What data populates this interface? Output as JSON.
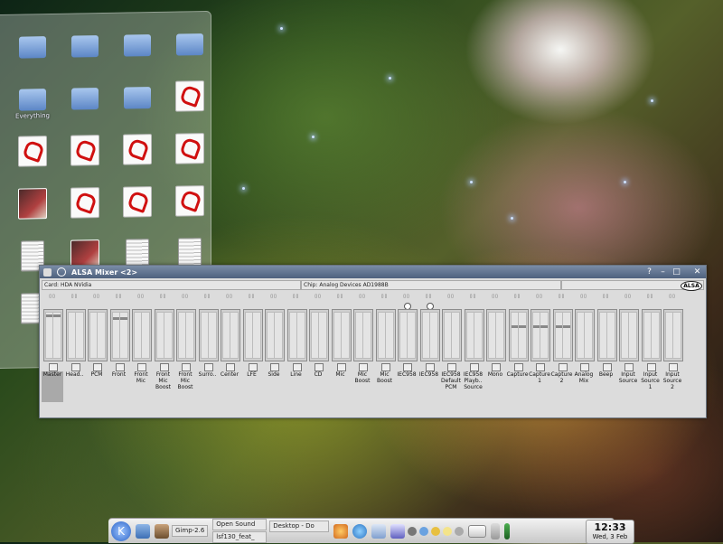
{
  "colors": {
    "titlebar": "#5b6e8a",
    "window_bg": "#dcdcdc"
  },
  "folder_view": {
    "items": [
      {
        "label": "",
        "type": "folder"
      },
      {
        "label": "",
        "type": "folder"
      },
      {
        "label": "",
        "type": "folder"
      },
      {
        "label": "",
        "type": "folder"
      },
      {
        "label": "Everything",
        "type": "folder"
      },
      {
        "label": "",
        "type": "folder"
      },
      {
        "label": "",
        "type": "folder"
      },
      {
        "label": "",
        "type": "pdf"
      },
      {
        "label": "",
        "type": "pdf"
      },
      {
        "label": "",
        "type": "pdf"
      },
      {
        "label": "",
        "type": "pdf"
      },
      {
        "label": "",
        "type": "pdf"
      },
      {
        "label": "",
        "type": "photo"
      },
      {
        "label": "",
        "type": "pdf"
      },
      {
        "label": "",
        "type": "pdf"
      },
      {
        "label": "",
        "type": "pdf"
      },
      {
        "label": "",
        "type": "doc"
      },
      {
        "label": "",
        "type": "photo"
      },
      {
        "label": "",
        "type": "doc"
      },
      {
        "label": "",
        "type": "doc"
      },
      {
        "label": "",
        "type": "doc"
      },
      {
        "label": "",
        "type": "tgz"
      },
      {
        "label": "",
        "type": "doc"
      },
      {
        "label": "",
        "type": "pdf"
      }
    ]
  },
  "mixer": {
    "title": "ALSA Mixer <2>",
    "card": "Card: HDA NVidia",
    "chip": "Chip: Analog Devices AD1988B",
    "logo": "ALSA",
    "channels": [
      {
        "name": "Master",
        "level": 0.95,
        "selected": true
      },
      {
        "name": "Head..",
        "level": 0
      },
      {
        "name": "PCM",
        "level": 0
      },
      {
        "name": "Front",
        "level": 0.9
      },
      {
        "name": "Front Mic",
        "level": 0
      },
      {
        "name": "Front Mic Boost",
        "level": 0
      },
      {
        "name": "Front Mic Boost",
        "level": 0
      },
      {
        "name": "Surro..",
        "level": 0
      },
      {
        "name": "Center",
        "level": 0
      },
      {
        "name": "LFE",
        "level": 0
      },
      {
        "name": "Side",
        "level": 0
      },
      {
        "name": "Line",
        "level": 0
      },
      {
        "name": "CD",
        "level": 0
      },
      {
        "name": "Mic",
        "level": 0
      },
      {
        "name": "Mic Boost",
        "level": 0
      },
      {
        "name": "Mic Boost",
        "level": 0
      },
      {
        "name": "IEC958",
        "level": 0,
        "jack": true
      },
      {
        "name": "IEC958",
        "level": 0,
        "jack": true
      },
      {
        "name": "IEC958 Default PCM",
        "level": 0
      },
      {
        "name": "IEC958 Playb.. Source",
        "level": 0
      },
      {
        "name": "Mono",
        "level": 0
      },
      {
        "name": "Capture",
        "level": 0.7
      },
      {
        "name": "Capture 1",
        "level": 0.7
      },
      {
        "name": "Capture 2",
        "level": 0.7
      },
      {
        "name": "Analog Mix",
        "level": 0
      },
      {
        "name": "Beep",
        "level": 0
      },
      {
        "name": "Input Source",
        "level": 0
      },
      {
        "name": "Input Source 1",
        "level": 0
      },
      {
        "name": "Input Source 2",
        "level": 0
      }
    ]
  },
  "taskbar": {
    "tasks": [
      "Gimp-2.6",
      "Open Sound",
      "Desktop - Do",
      "lsf130_feat_"
    ],
    "clock_time": "12:33",
    "clock_date": "Wed, 3 Feb"
  }
}
